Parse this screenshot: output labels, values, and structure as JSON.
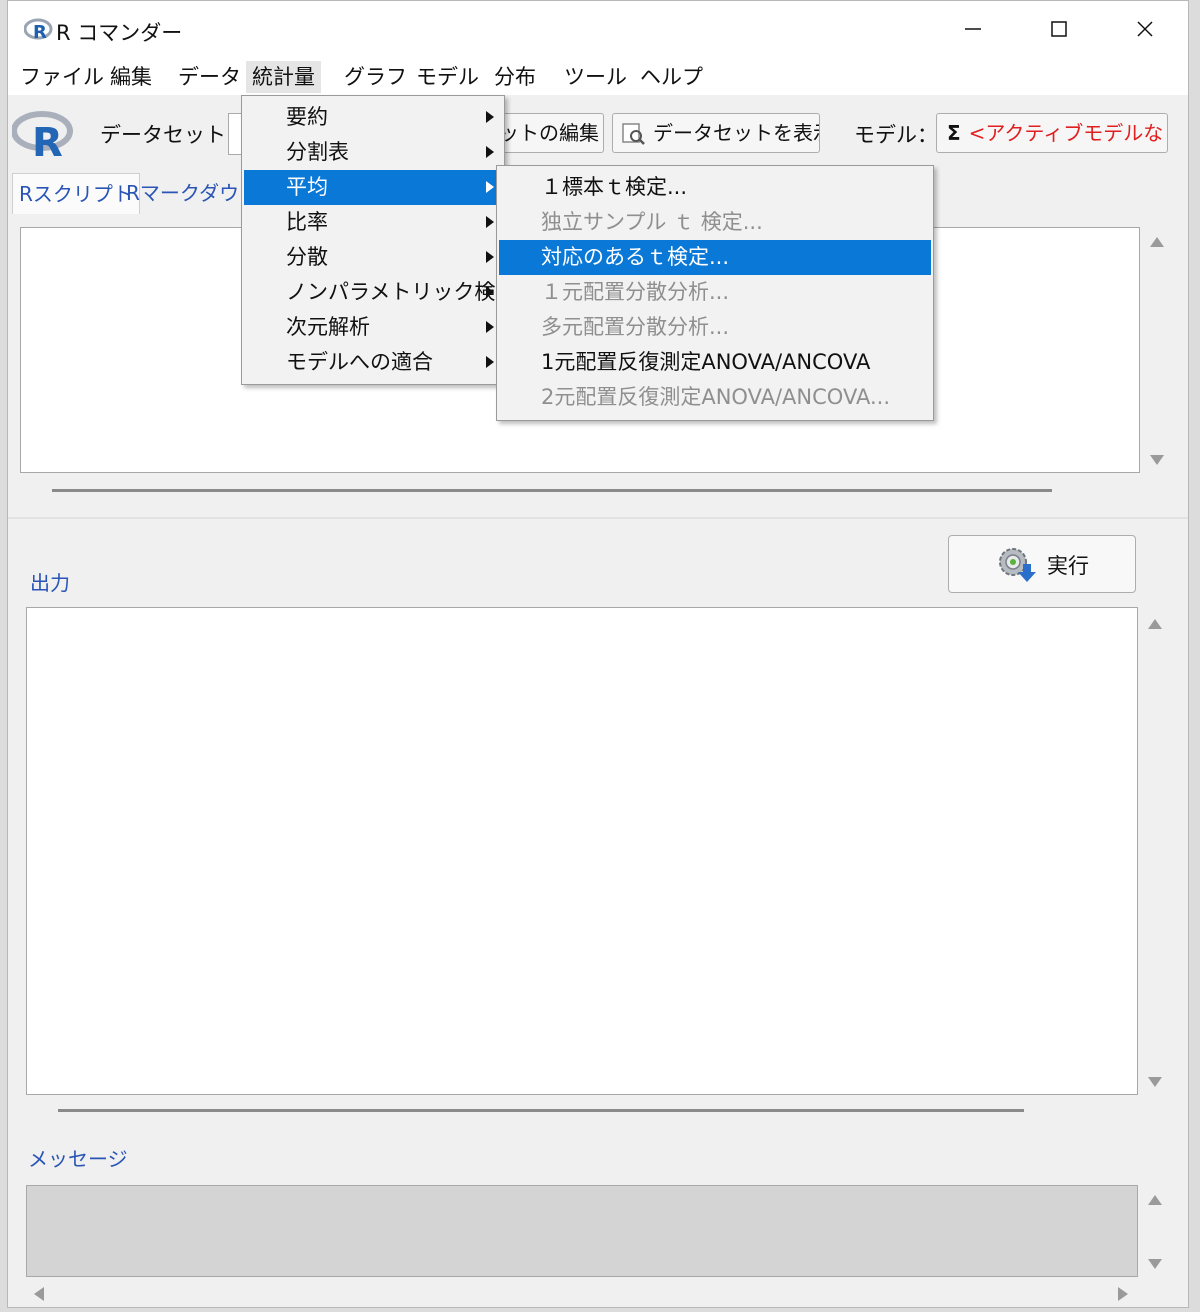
{
  "window": {
    "title": "R コマンダー"
  },
  "menubar": [
    {
      "label": "ファイル"
    },
    {
      "label": "編集"
    },
    {
      "label": "データ"
    },
    {
      "label": "統計量"
    },
    {
      "label": "グラフ"
    },
    {
      "label": "モデル"
    },
    {
      "label": "分布"
    },
    {
      "label": "ツール"
    },
    {
      "label": "ヘルプ"
    }
  ],
  "toolbar": {
    "dataset_label": "データセット：",
    "edit_dataset_label": "ットの編集",
    "view_dataset_label": "データセットを表示",
    "model_label": "モデル：",
    "model_sigma": "Σ",
    "model_value": "<アクティブモデルなし>"
  },
  "tabs": [
    {
      "label": "Rスクリプト"
    },
    {
      "label": "Rマークダウン"
    }
  ],
  "output": {
    "label": "出力",
    "run_label": "実行"
  },
  "messages": {
    "label": "メッセージ"
  },
  "statistics_menu": [
    {
      "label": "要約",
      "has_submenu": true
    },
    {
      "label": "分割表",
      "has_submenu": true
    },
    {
      "label": "平均",
      "has_submenu": true,
      "highlighted": true
    },
    {
      "label": "比率",
      "has_submenu": true
    },
    {
      "label": "分散",
      "has_submenu": true
    },
    {
      "label": "ノンパラメトリック検定",
      "has_submenu": true
    },
    {
      "label": "次元解析",
      "has_submenu": true
    },
    {
      "label": "モデルへの適合",
      "has_submenu": true
    }
  ],
  "means_submenu": [
    {
      "label": "１標本ｔ検定...",
      "enabled": true
    },
    {
      "label": "独立サンプル ｔ 検定...",
      "enabled": false
    },
    {
      "label": "対応のあるｔ検定...",
      "enabled": true,
      "highlighted": true
    },
    {
      "label": "１元配置分散分析...",
      "enabled": false
    },
    {
      "label": "多元配置分散分析...",
      "enabled": false
    },
    {
      "label": "1元配置反復測定ANOVA/ANCOVA",
      "enabled": true
    },
    {
      "label": "2元配置反復測定ANOVA/ANCOVA...",
      "enabled": false
    }
  ],
  "colors": {
    "highlight": "#0a78d7",
    "link_blue": "#2a55b5",
    "model_red": "#e02020"
  }
}
